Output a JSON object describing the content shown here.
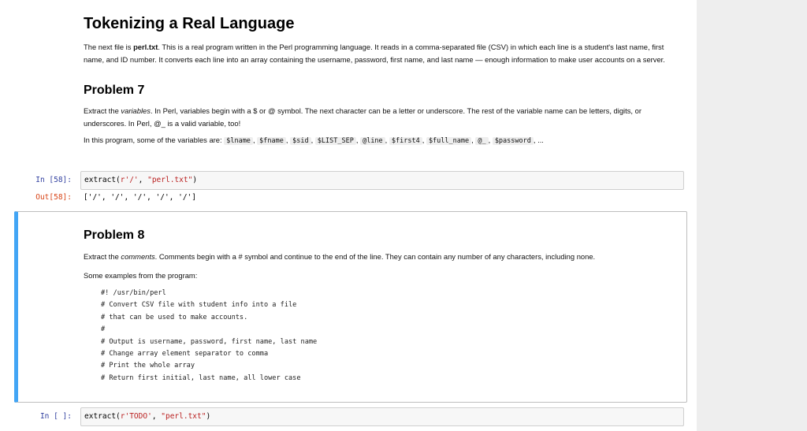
{
  "md1": {
    "title": "Tokenizing a Real Language",
    "p1_a": "The next file is ",
    "p1_file": "perl.txt",
    "p1_b": ". This is a real program written in the Perl programming language. It reads in a comma-separated file (CSV) in which each line is a student's last name, first name, and ID number. It converts each line into an array containing the username, password, first name, and last name — enough information to make user accounts on a server.",
    "problem_heading": "Problem 7",
    "p2_a": "Extract the ",
    "p2_em": "variables",
    "p2_b": ". In Perl, variables begin with a $ or @ symbol. The next character can be a letter or underscore. The rest of the variable name can be letters, digits, or underscores. In Perl, @_ is a valid variable, too!",
    "p3_a": "In this program, some of the variables are: ",
    "variables": [
      "$lname",
      "$fname",
      "$sid",
      "$LIST_SEP",
      "@line",
      "$first4",
      "$full_name",
      "@_",
      "$password"
    ],
    "p3_end": "..."
  },
  "cell1": {
    "in_prompt": "In [58]:",
    "code_func": "extract(",
    "code_arg1": "r'/'",
    "code_sep": ", ",
    "code_arg2": "\"perl.txt\"",
    "code_close": ")",
    "out_prompt": "Out[58]:",
    "output": "['/', '/', '/', '/', '/']"
  },
  "md2": {
    "heading": "Problem 8",
    "p1_a": "Extract the ",
    "p1_em": "comments",
    "p1_b": ". Comments begin with a # symbol and continue to the end of the line. They can contain any number of any characters, including none.",
    "p2": "Some examples from the program:",
    "code_lines": [
      "#! /usr/bin/perl",
      "# Convert CSV file with student info into a file",
      "# that can be used to make accounts.",
      "#",
      "# Output is username, password, first name, last name",
      "# Change array element separator to comma",
      "# Print the whole array",
      "# Return first initial, last name, all lower case"
    ]
  },
  "cell2": {
    "in_prompt": "In [ ]:",
    "code_func": "extract(",
    "code_arg1": "r'TODO'",
    "code_sep": ", ",
    "code_arg2": "\"perl.txt\"",
    "code_close": ")"
  }
}
